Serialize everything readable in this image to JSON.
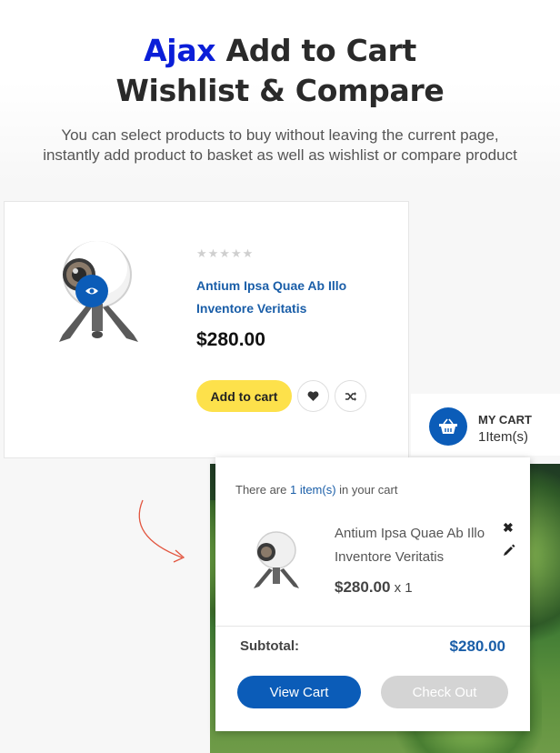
{
  "hero": {
    "title_accent": "Ajax",
    "title_line1_rest": " Add to Cart",
    "title_line2": "Wishlist & Compare",
    "subtitle_line1": "You can select products to buy without leaving the current page,",
    "subtitle_line2": "instantly add product to basket as well as wishlist or compare product"
  },
  "product": {
    "rating_stars": "★★★★★",
    "name": "Antium Ipsa Quae Ab Illo Inventore Veritatis",
    "price": "$280.00",
    "add_to_cart_label": "Add to cart",
    "icons": [
      "eye-icon",
      "heart-icon",
      "shuffle-icon"
    ]
  },
  "mini_cart": {
    "title": "MY CART",
    "count": "1Item(s)",
    "icon": "basket-icon"
  },
  "cart_dropdown": {
    "info_prefix": "There are ",
    "info_highlight": "1 item(s)",
    "info_suffix": " in your cart",
    "item_name": "Antium Ipsa Quae Ab Illo Inventore Veritatis",
    "item_price": "$280.00",
    "item_qty": " x 1",
    "remove_symbol": "✖",
    "subtotal_label": "Subtotal:",
    "subtotal_value": "$280.00",
    "view_cart_label": "View Cart",
    "checkout_label": "Check Out"
  },
  "colors": {
    "accent_blue": "#0b5cb8",
    "title_accent": "#0a1ed8",
    "add_button": "#fde14b",
    "checkout_disabled": "#d4d4d4",
    "arrow": "#e2553f"
  }
}
